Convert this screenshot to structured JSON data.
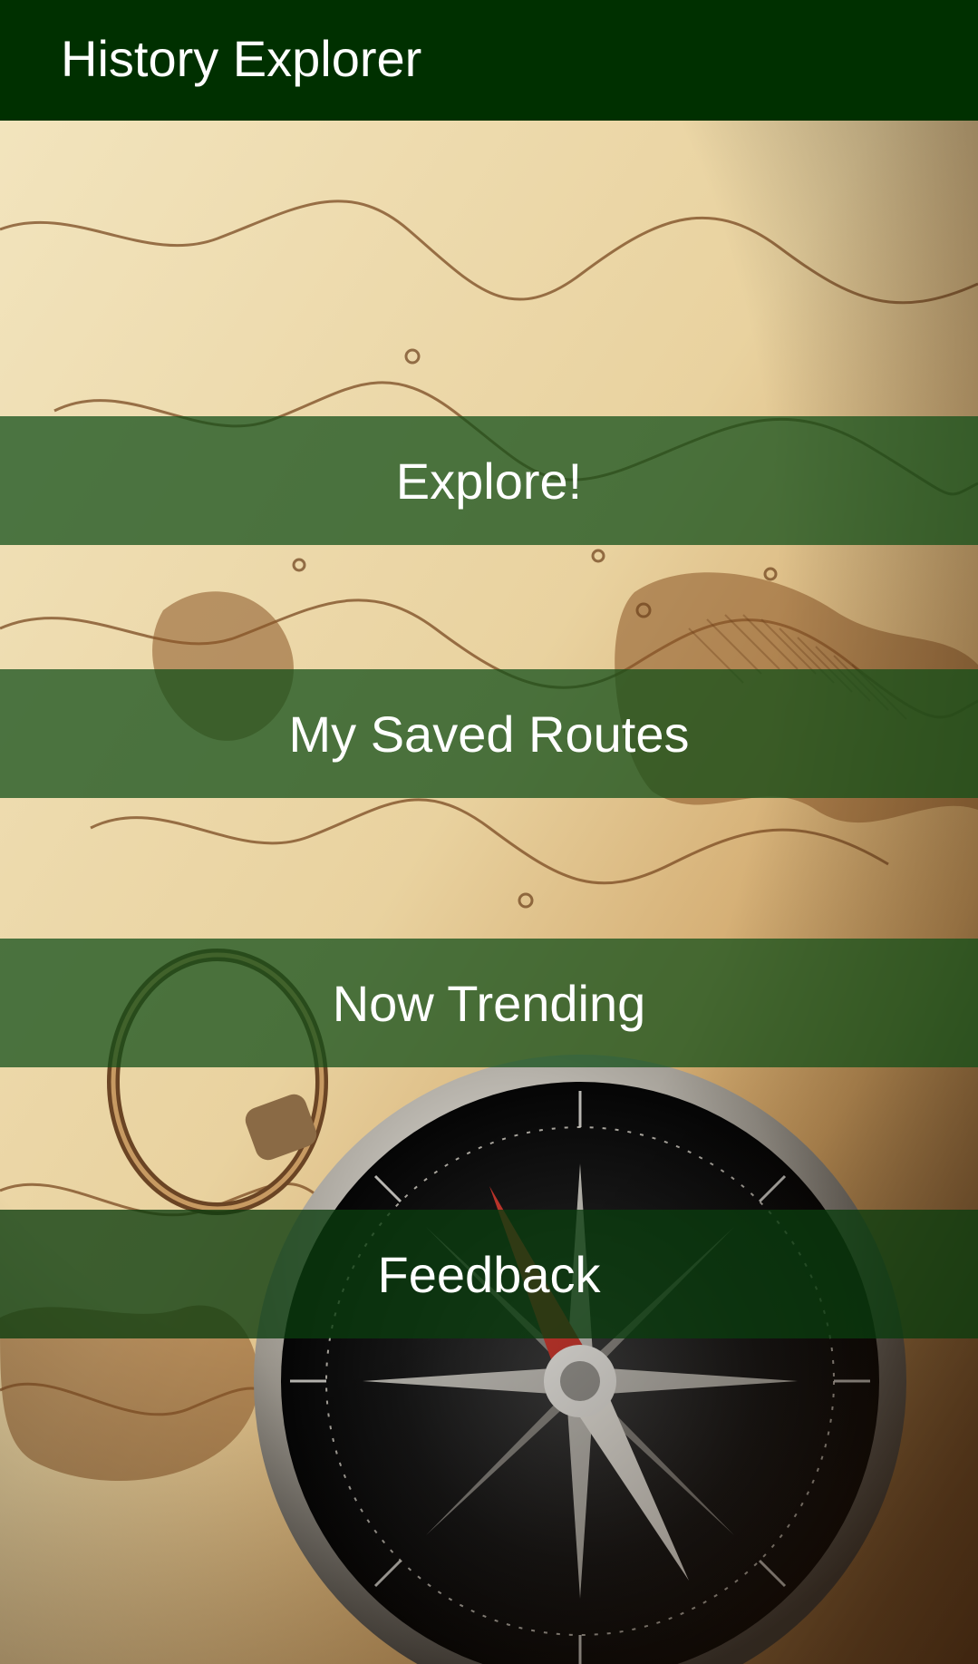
{
  "app_bar": {
    "title": "History Explorer",
    "background_color": "#003000"
  },
  "background": {
    "map-and-compass-image": "antique map with compass"
  },
  "menu": {
    "items": [
      {
        "label": "Explore!"
      },
      {
        "label": "My Saved Routes"
      },
      {
        "label": "Now Trending"
      },
      {
        "label": "Feedback"
      }
    ],
    "button_color": "#124e18",
    "label_color": "#ffffff"
  }
}
